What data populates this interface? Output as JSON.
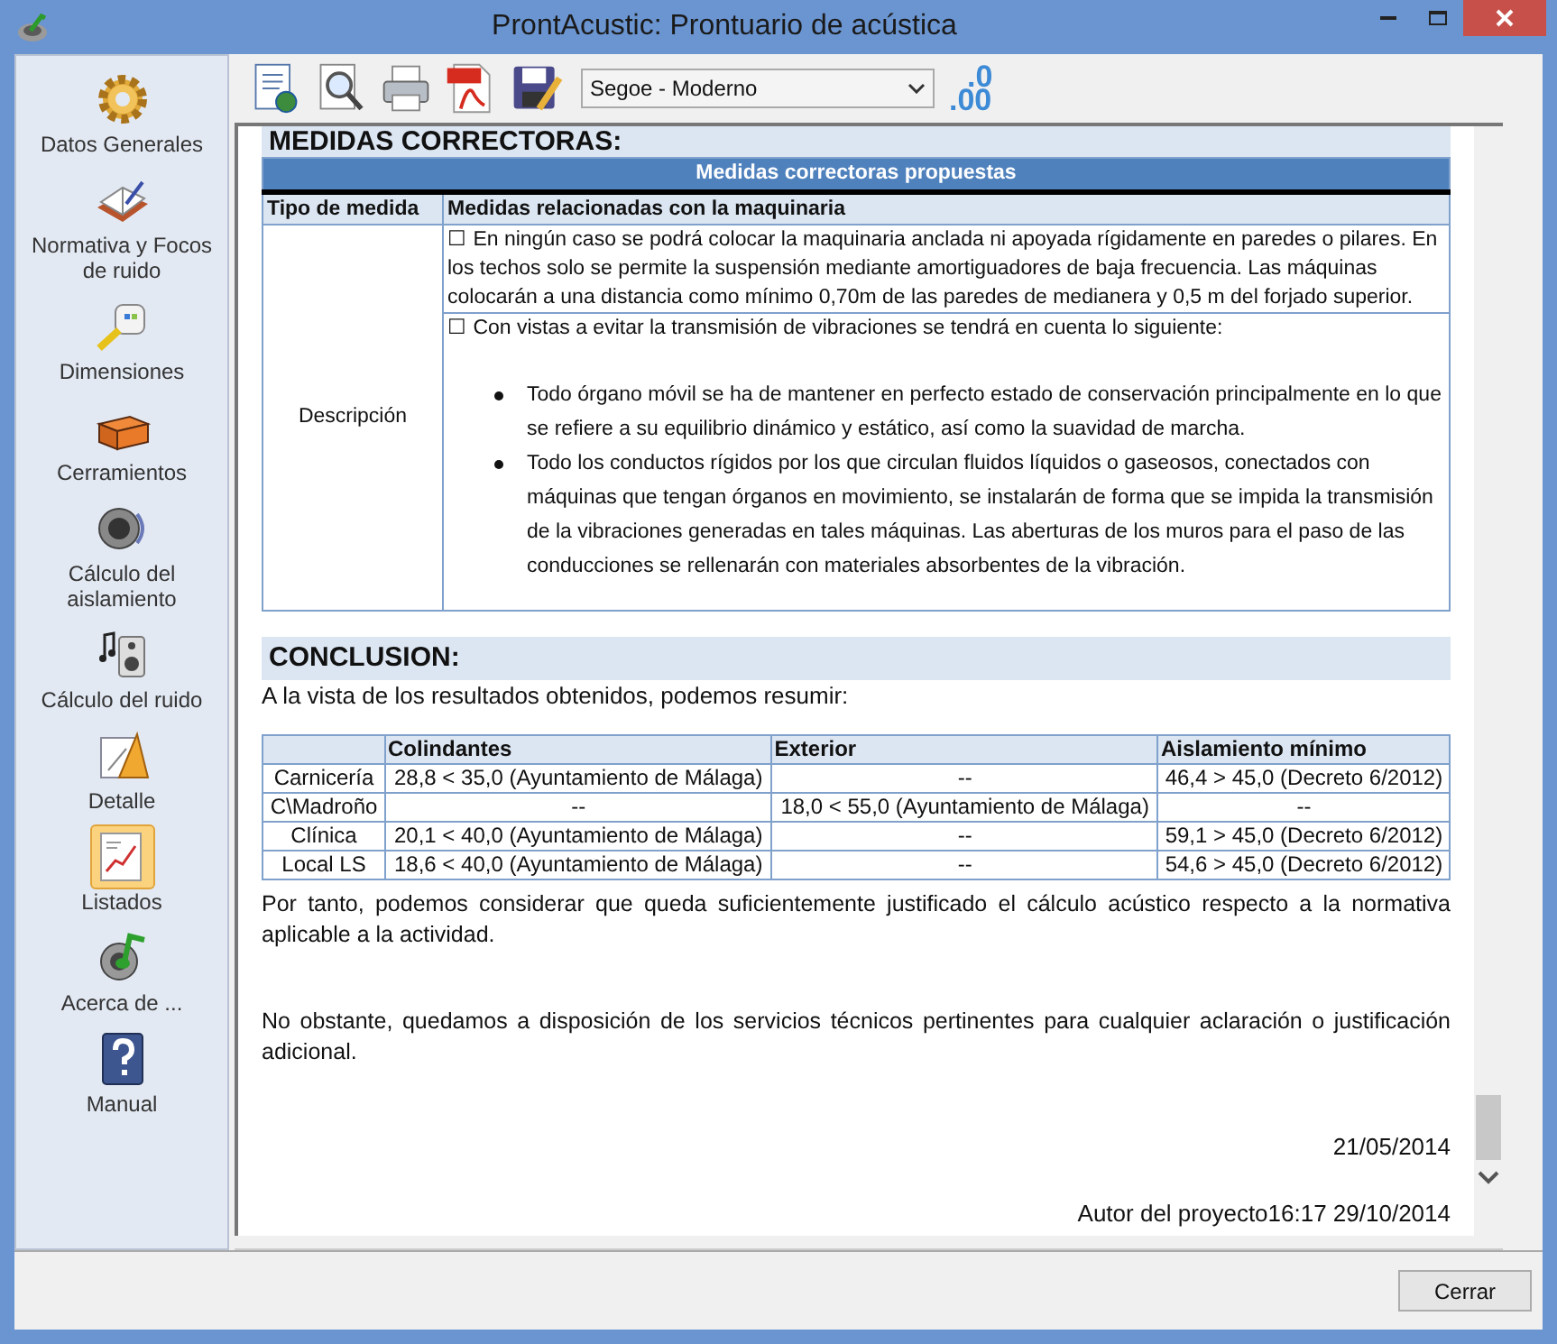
{
  "window": {
    "title": "ProntAcustic: Prontuario de acústica"
  },
  "sidebar": {
    "items": [
      {
        "label": "Datos Generales",
        "selected": false
      },
      {
        "label": "Normativa y Focos de ruido",
        "selected": false
      },
      {
        "label": "Dimensiones",
        "selected": false
      },
      {
        "label": "Cerramientos",
        "selected": false
      },
      {
        "label": "Cálculo del aislamiento",
        "selected": false
      },
      {
        "label": "Cálculo del ruido",
        "selected": false
      },
      {
        "label": "Detalle",
        "selected": false
      },
      {
        "label": "Listados",
        "selected": true
      },
      {
        "label": "Acerca de ...",
        "selected": false
      },
      {
        "label": "Manual",
        "selected": false
      }
    ]
  },
  "toolbar": {
    "font_select": "Segoe - Moderno",
    "decimal_button": {
      "top": ".0",
      "bottom": ".00"
    }
  },
  "document": {
    "section_title": "MEDIDAS CORRECTORAS:",
    "measures_table": {
      "caption": "Medidas correctoras propuestas",
      "columns": [
        "Tipo de medida",
        "Medidas relacionadas con la maquinaria"
      ],
      "row_label": "Descripción",
      "items": [
        {
          "kind": "paragraph",
          "text": "☐ En ningún caso se podrá colocar la maquinaria anclada ni apoyada rígidamente en paredes o pilares. En los techos solo se permite la suspensión mediante amortiguadores de baja frecuencia. Las máquinas colocarán a una distancia como mínimo 0,70m de las paredes de medianera y 0,5 m del forjado superior."
        },
        {
          "kind": "list",
          "text": "☐ Con vistas a evitar la transmisión de vibraciones se tendrá en cuenta lo siguiente:",
          "bullets": [
            "Todo órgano móvil se ha de mantener en perfecto estado de conservación principalmente en lo que se refiere a su equilibrio dinámico y estático, así como la suavidad de marcha.",
            "Todo los conductos rígidos por los que circulan fluidos líquidos o gaseosos, conectados con máquinas que tengan órganos en movimiento, se instalarán de forma que se impida la transmisión de la vibraciones generadas en tales máquinas. Las aberturas de los muros para el paso de las conducciones se rellenarán con materiales absorbentes de la vibración."
          ]
        }
      ]
    },
    "conclusion_title": "CONCLUSION:",
    "intro": "A la vista de los resultados obtenidos, podemos resumir:",
    "results_table": {
      "columns": [
        "Colindantes",
        "Exterior",
        "Aislamiento mínimo"
      ],
      "rows": [
        {
          "label": "Carnicería",
          "cells": [
            "28,8 < 35,0 (Ayuntamiento de Málaga)",
            "--",
            "46,4 > 45,0 (Decreto 6/2012)"
          ]
        },
        {
          "label": "C\\Madroño",
          "cells": [
            "--",
            "18,0 < 55,0 (Ayuntamiento de Málaga)",
            "--"
          ]
        },
        {
          "label": "Clínica",
          "cells": [
            "20,1 < 40,0 (Ayuntamiento de Málaga)",
            "--",
            "59,1 > 45,0 (Decreto 6/2012)"
          ]
        },
        {
          "label": "Local LS",
          "cells": [
            "18,6 < 40,0 (Ayuntamiento de Málaga)",
            "--",
            "54,6 > 45,0 (Decreto 6/2012)"
          ]
        }
      ]
    },
    "paragraphs": [
      "Por tanto, podemos considerar que queda suficientemente justificado el cálculo acústico respecto a la normativa aplicable a la actividad.",
      "No obstante, quedamos a disposición de los servicios técnicos pertinentes para cualquier aclaración o justificación adicional."
    ],
    "date": "21/05/2014",
    "author_line": "Autor del proyecto16:17 29/10/2014"
  },
  "buttons": [
    "Cerrar"
  ]
}
